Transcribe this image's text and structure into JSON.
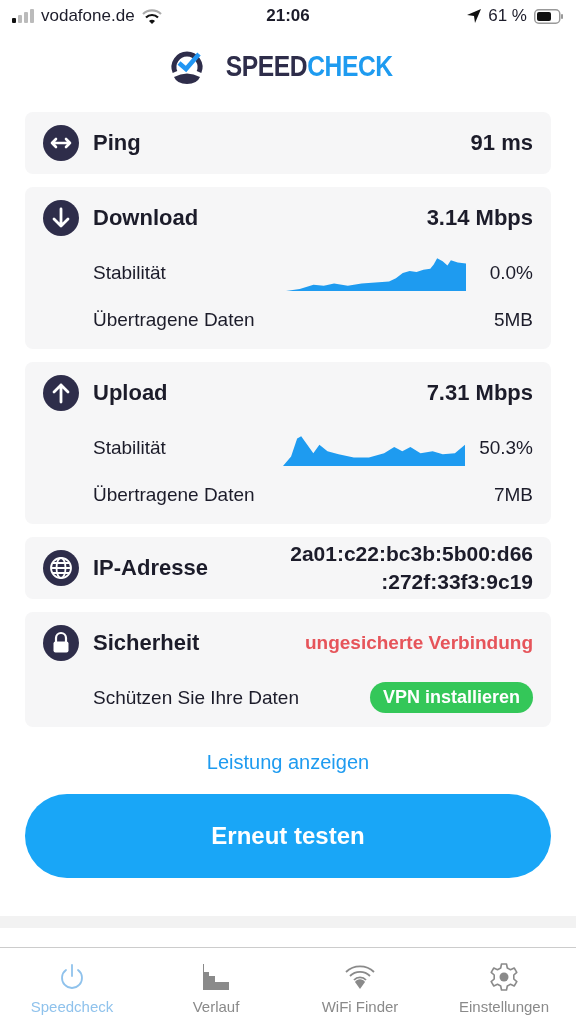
{
  "status_bar": {
    "carrier": "vodafone.de",
    "time": "21:06",
    "battery": "61 %"
  },
  "logo": {
    "part_1": "SPEED",
    "part_2": "CHECK"
  },
  "ping": {
    "label": "Ping",
    "value": "91 ms"
  },
  "download": {
    "label": "Download",
    "value": "3.14 Mbps",
    "stability_label": "Stabilität",
    "stability": "0.0%",
    "data_label": "Übertragene Daten",
    "data": "5MB"
  },
  "upload": {
    "label": "Upload",
    "value": "7.31 Mbps",
    "stability_label": "Stabilität",
    "stability": "50.3%",
    "data_label": "Übertragene Daten",
    "data": "7MB"
  },
  "ip": {
    "label": "IP-Adresse",
    "value_lines": [
      "2a01:c22:bc3b:5b00:d66",
      ":272f:33f3:9c19"
    ]
  },
  "security": {
    "label": "Sicherheit",
    "status": "ungesicherte Verbindung",
    "hint": "Schützen Sie Ihre Daten",
    "vpn_button": "VPN installieren"
  },
  "link": "Leistung anzeigen",
  "retest_button": "Erneut testen",
  "tabs": [
    {
      "label": "Speedcheck",
      "kind": "power",
      "selected": true
    },
    {
      "label": "Verlauf",
      "kind": "history",
      "selected": false
    },
    {
      "label": "WiFi Finder",
      "kind": "wifi",
      "selected": false
    },
    {
      "label": "Einstellungen",
      "kind": "settings",
      "selected": false
    }
  ]
}
